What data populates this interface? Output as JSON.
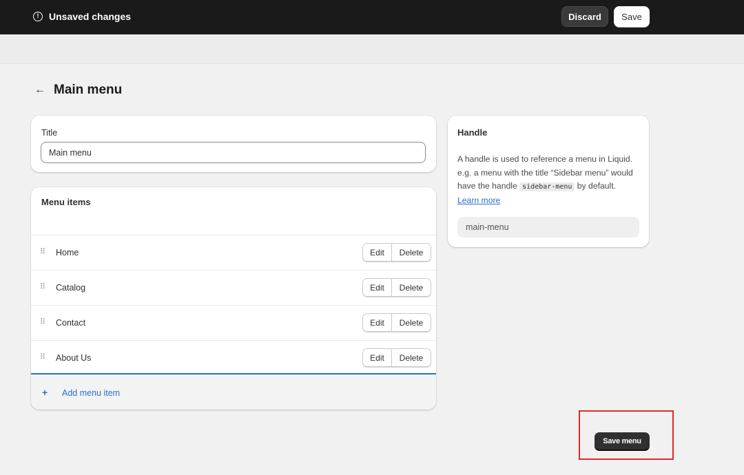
{
  "topbar": {
    "status_icon": "info-icon",
    "status_text": "Unsaved changes",
    "discard_label": "Discard",
    "save_label": "Save"
  },
  "page": {
    "back_icon": "arrow-left-icon",
    "back_glyph": "←",
    "title": "Main menu"
  },
  "title_card": {
    "label": "Title",
    "value": "Main menu"
  },
  "menu_card": {
    "title": "Menu items",
    "drag_glyph": "⠿",
    "items": [
      {
        "label": "Home",
        "edit": "Edit",
        "delete": "Delete"
      },
      {
        "label": "Catalog",
        "edit": "Edit",
        "delete": "Delete"
      },
      {
        "label": "Contact",
        "edit": "Edit",
        "delete": "Delete"
      },
      {
        "label": "About Us",
        "edit": "Edit",
        "delete": "Delete"
      }
    ],
    "add_glyph": "+",
    "add_label": "Add menu item"
  },
  "handle_card": {
    "title": "Handle",
    "desc_1": "A handle is used to reference a menu in Liquid. e.g. a menu with the title “Sidebar menu” would have the handle ",
    "code": "sidebar-menu",
    "desc_2": " by default.",
    "learn_more": "Learn more",
    "value": "main-menu"
  },
  "footer": {
    "save_menu_label": "Save menu"
  },
  "colors": {
    "topbar_bg": "#1a1a1a",
    "link": "#2c6ecb",
    "annotation": "#e0282a"
  }
}
